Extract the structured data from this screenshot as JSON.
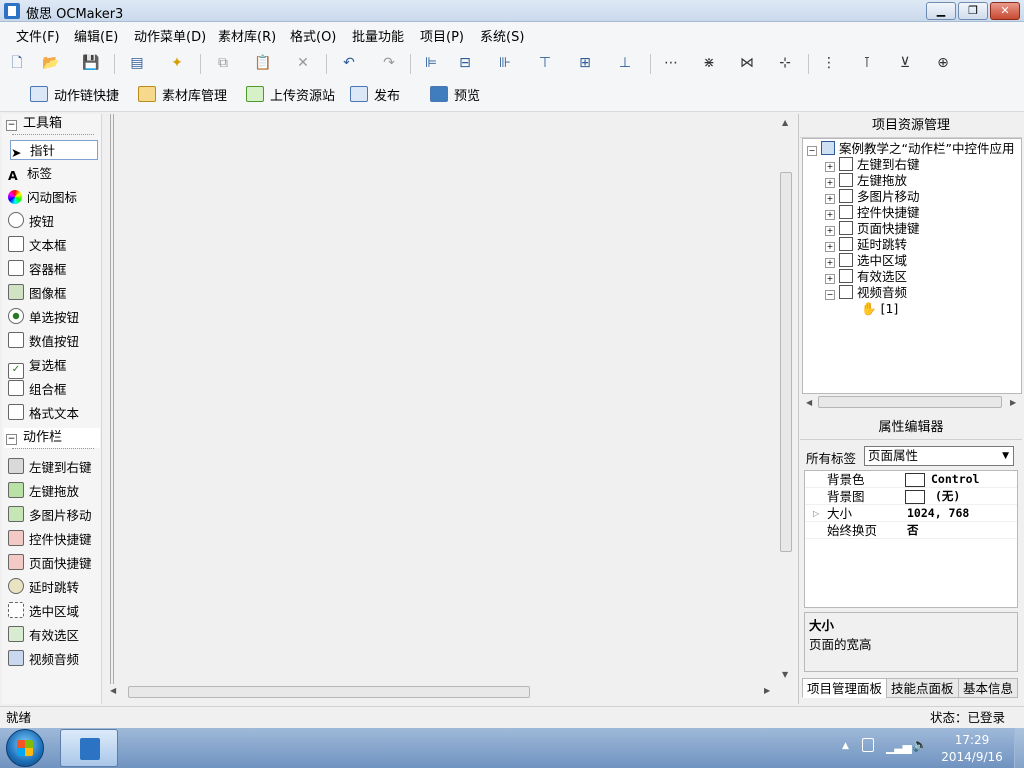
{
  "window": {
    "title": "傲思 OCMaker3",
    "min": "▁",
    "max": "❐",
    "close": "✕"
  },
  "menu": [
    "文件(F)",
    "编辑(E)",
    "动作菜单(D)",
    "素材库(R)",
    "格式(O)",
    "批量功能",
    "项目(P)",
    "系统(S)"
  ],
  "toolbar2": [
    "动作链快捷",
    "素材库管理",
    "上传资源站",
    "发布",
    "预览"
  ],
  "toolbox": {
    "header_tools": "工具箱",
    "tools": [
      "指针",
      "标签",
      "闪动图标",
      "按钮",
      "文本框",
      "容器框",
      "图像框",
      "单选按钮",
      "数值按钮",
      "复选框",
      "组合框",
      "格式文本"
    ],
    "header_actions": "动作栏",
    "actions": [
      "左键到右键",
      "左键拖放",
      "多图片移动",
      "控件快捷键",
      "页面快捷键",
      "延时跳转",
      "选中区域",
      "有效选区",
      "视频音频"
    ]
  },
  "project_panel": {
    "title": "项目资源管理",
    "root": "案例教学之“动作栏”中控件应用",
    "items": [
      "左键到右键",
      "左键拖放",
      "多图片移动",
      "控件快捷键",
      "页面快捷键",
      "延时跳转",
      "选中区域",
      "有效选区",
      "视频音频"
    ],
    "child": "[1]"
  },
  "property_editor": {
    "title": "属性编辑器",
    "tag_label": "所有标签",
    "tag_value": "页面属性",
    "rows": [
      {
        "name": "背景色",
        "value": "Control"
      },
      {
        "name": "背景图",
        "value": "(无)"
      },
      {
        "name": "大小",
        "value": "1024, 768"
      },
      {
        "name": "始终换页",
        "value": "否"
      }
    ],
    "desc_title": "大小",
    "desc_text": "页面的宽高"
  },
  "tabs": [
    "项目管理面板",
    "技能点面板",
    "基本信息"
  ],
  "status": {
    "left": "就绪",
    "right": "状态：已登录"
  },
  "taskbar": {
    "time": "17:29",
    "date": "2014/9/16"
  }
}
